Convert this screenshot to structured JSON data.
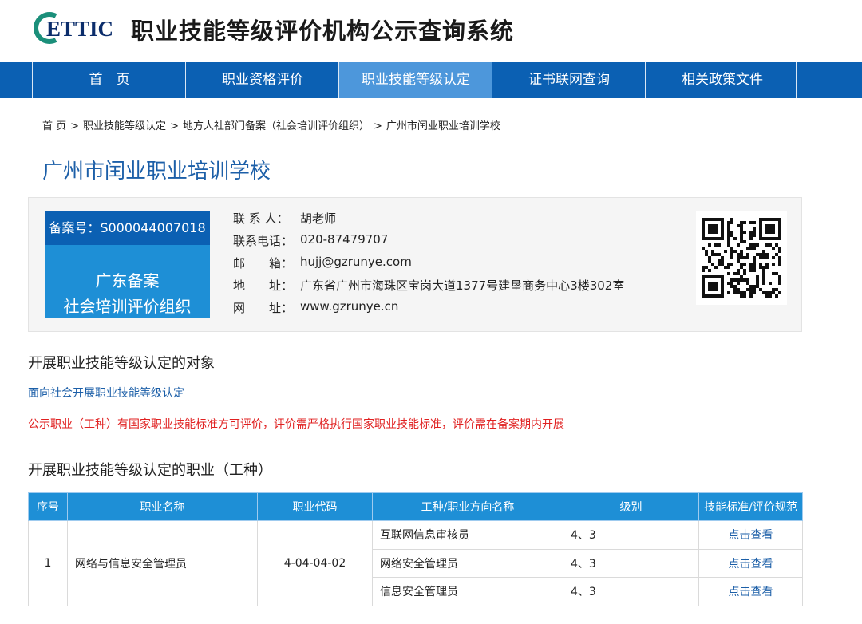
{
  "header": {
    "logo_text": "ETTIC",
    "site_title": "职业技能等级评价机构公示查询系统"
  },
  "nav": {
    "items": [
      {
        "label": "首　页"
      },
      {
        "label": "职业资格评价"
      },
      {
        "label": "职业技能等级认定"
      },
      {
        "label": "证书联网查询"
      },
      {
        "label": "相关政策文件"
      }
    ],
    "active_index": 2,
    "active_color": "#4d97db",
    "bar_color": "#0b60b3"
  },
  "breadcrumb": {
    "items": [
      "首 页",
      "职业技能等级认定",
      "地方人社部门备案（社会培训评价组织）",
      "广州市闰业职业培训学校"
    ],
    "separator": ">"
  },
  "org": {
    "name": "广州市闰业职业培训学校",
    "registration_no": "备案号：S000044007018",
    "category_line1": "广东备案",
    "category_line2": "社会培训评价组织",
    "contact": [
      {
        "label": "联 系 人：",
        "value": "胡老师"
      },
      {
        "label": "联系电话：",
        "value": "020-87479707"
      },
      {
        "label": "邮　　箱：",
        "value": "hujj@gzrunye.com"
      },
      {
        "label": "地　　址：",
        "value": "广东省广州市海珠区宝岗大道1377号建垦商务中心3楼302室"
      },
      {
        "label": "网　　址：",
        "value": "www.gzrunye.cn"
      }
    ],
    "qr_icon": "qr-code-icon"
  },
  "section_target": {
    "heading": "开展职业技能等级认定的对象",
    "link": "面向社会开展职业技能等级认定",
    "notice": "公示职业（工种）有国家职业技能标准方可评价，评价需严格执行国家职业技能标准，评价需在备案期内开展",
    "notice_color": "#e02020"
  },
  "section_occupations": {
    "heading": "开展职业技能等级认定的职业（工种）",
    "columns": [
      "序号",
      "职业名称",
      "职业代码",
      "工种/职业方向名称",
      "级别",
      "技能标准/评价规范"
    ],
    "rows": [
      {
        "seq": "1",
        "occupation": "网络与信息安全管理员",
        "code": "4-04-04-02",
        "subs": [
          {
            "name": "互联网信息审核员",
            "level": "4、3",
            "link": "点击查看"
          },
          {
            "name": "网络安全管理员",
            "level": "4、3",
            "link": "点击查看"
          },
          {
            "name": "信息安全管理员",
            "level": "4、3",
            "link": "点击查看"
          }
        ]
      }
    ],
    "header_color": "#1e8fd6"
  }
}
